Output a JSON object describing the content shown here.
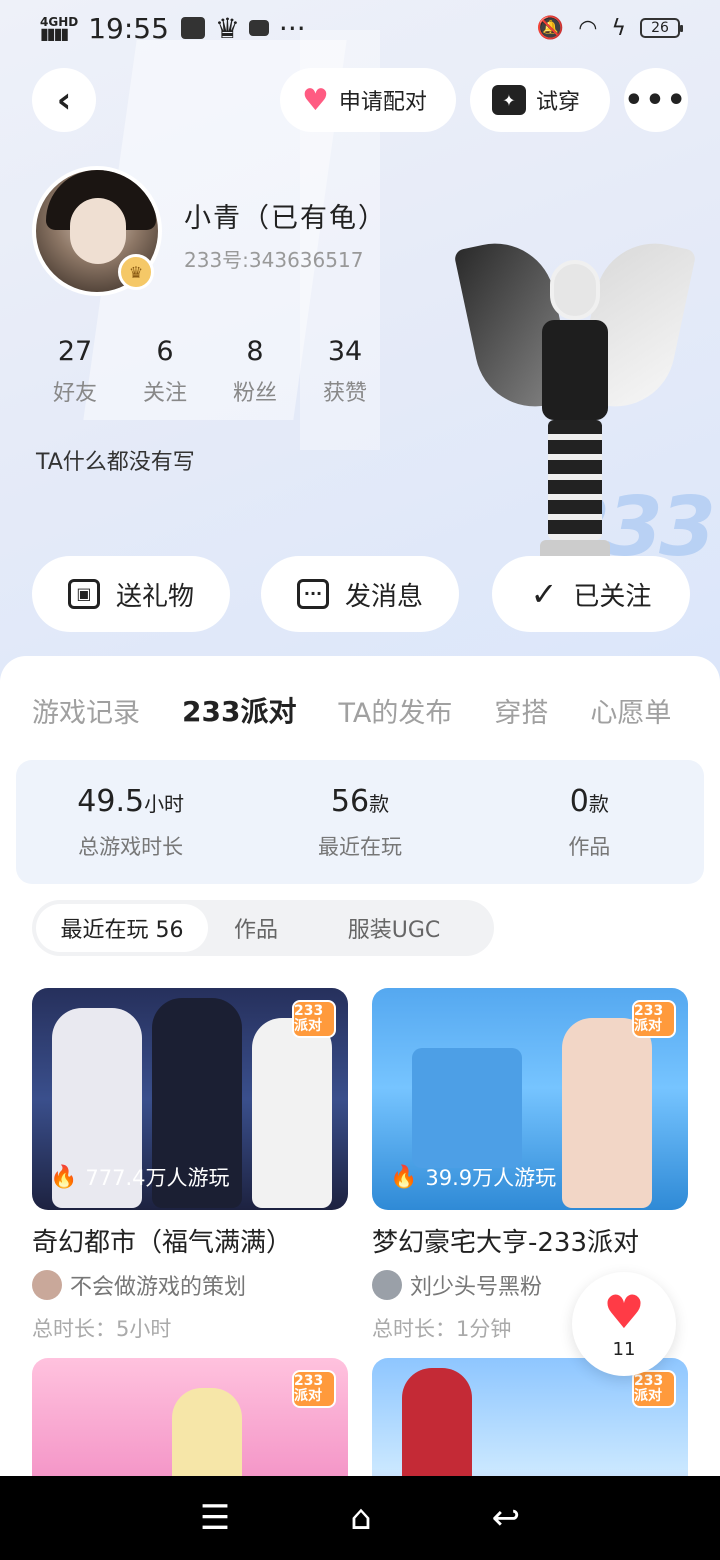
{
  "status_bar": {
    "network": "4GHD",
    "time": "19:55",
    "battery": "26"
  },
  "header": {
    "back_icon": "chevron-left-icon",
    "pair_label": "申请配对",
    "try_label": "试穿",
    "more_icon": "more-dots-icon"
  },
  "profile": {
    "name": "小青（已有龟）",
    "id": "233号:343636517",
    "stats": [
      {
        "num": "27",
        "label": "好友"
      },
      {
        "num": "6",
        "label": "关注"
      },
      {
        "num": "8",
        "label": "粉丝"
      },
      {
        "num": "34",
        "label": "获赞"
      }
    ],
    "bio": "TA什么都没有写"
  },
  "actions": {
    "gift": "送礼物",
    "message": "发消息",
    "follow": "已关注"
  },
  "tabs": [
    "游戏记录",
    "233派对",
    "TA的发布",
    "穿搭",
    "心愿单"
  ],
  "summary": [
    {
      "value": "49.5",
      "unit": "小时",
      "label": "总游戏时长"
    },
    {
      "value": "56",
      "unit": "款",
      "label": "最近在玩"
    },
    {
      "value": "0",
      "unit": "款",
      "label": "作品"
    }
  ],
  "subtabs": [
    "最近在玩 56",
    "作品",
    "服装UGC"
  ],
  "badge_text": "233派对",
  "games": [
    {
      "title": "奇幻都市（福气满满）",
      "plays": "777.4万人游玩",
      "author": "不会做游戏的策划",
      "duration": "总时长：5小时"
    },
    {
      "title": "梦幻豪宅大亨-233派对",
      "plays": "39.9万人游玩",
      "author": "刘少头号黑粉",
      "duration": "总时长：1分钟"
    }
  ],
  "like": {
    "count": "11"
  },
  "colors": {
    "accent": "#ff7a2a",
    "heart": "#ff3b46",
    "summary_bg": "#eef3fb"
  }
}
